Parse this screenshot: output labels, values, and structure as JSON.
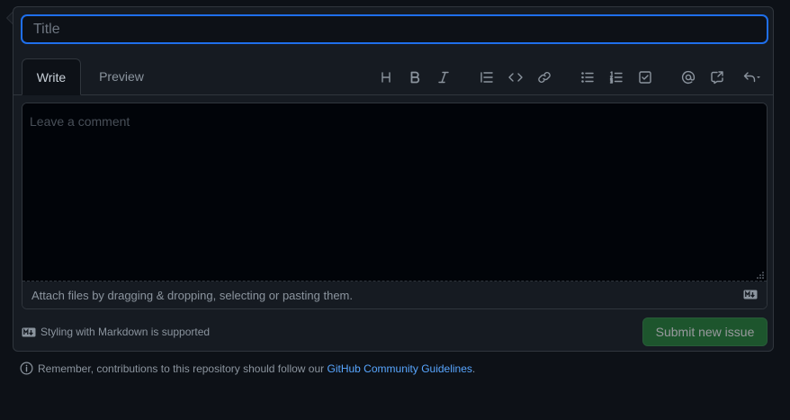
{
  "title_input": {
    "placeholder": "Title",
    "value": ""
  },
  "tabs": [
    {
      "label": "Write"
    },
    {
      "label": "Preview"
    }
  ],
  "toolbar": {
    "heading_glyph": "H",
    "buttons": [
      "heading-icon",
      "bold-icon",
      "italic-icon",
      "quote-icon",
      "code-icon",
      "link-icon",
      "unordered-list-icon",
      "ordered-list-icon",
      "task-list-icon",
      "mention-icon",
      "cross-reference-icon",
      "saved-replies-icon"
    ]
  },
  "comment": {
    "placeholder": "Leave a comment",
    "attach_text": "Attach files by dragging & dropping, selecting or pasting them."
  },
  "footer": {
    "markdown_hint": "Styling with Markdown is supported",
    "submit_label": "Submit new issue"
  },
  "guidelines": {
    "prefix": "Remember, contributions to this repository should follow our",
    "link_text": "GitHub Community Guidelines",
    "suffix": "."
  },
  "colors": {
    "background": "#0d1117",
    "accent_border": "#1f6feb",
    "submit_green": "#238636",
    "link_blue": "#58a6ff"
  }
}
